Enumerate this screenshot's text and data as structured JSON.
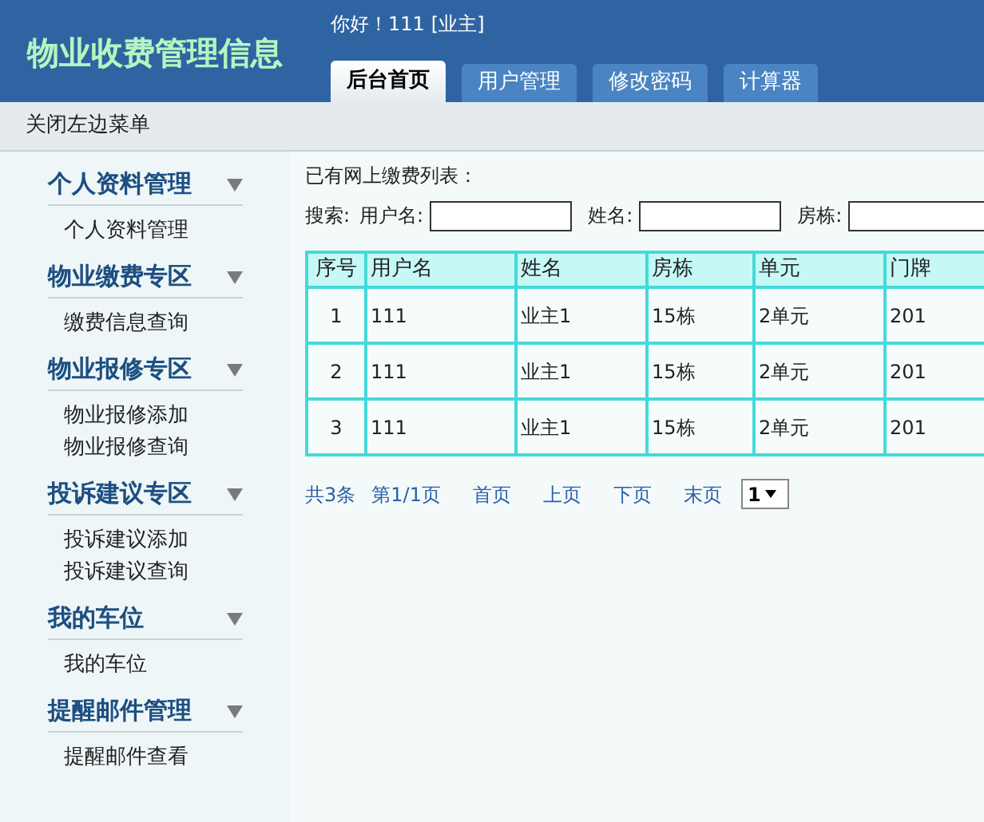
{
  "header": {
    "title": "物业收费管理信息",
    "greeting": "你好！111",
    "role": "[业主]"
  },
  "tabs": [
    {
      "label": "后台首页",
      "selected": true
    },
    {
      "label": "用户管理",
      "selected": false
    },
    {
      "label": "修改密码",
      "selected": false
    },
    {
      "label": "计算器",
      "selected": false
    }
  ],
  "toolbar": {
    "toggle_menu": "关闭左边菜单"
  },
  "sidebar": {
    "sections": [
      {
        "title": "个人资料管理",
        "expanded": true,
        "items": [
          "个人资料管理"
        ]
      },
      {
        "title": "物业缴费专区",
        "expanded": true,
        "items": [
          "缴费信息查询"
        ]
      },
      {
        "title": "物业报修专区",
        "expanded": true,
        "items": [
          "物业报修添加",
          "物业报修查询"
        ]
      },
      {
        "title": "投诉建议专区",
        "expanded": true,
        "items": [
          "投诉建议添加",
          "投诉建议查询"
        ]
      },
      {
        "title": "我的车位",
        "expanded": true,
        "items": [
          "我的车位"
        ]
      },
      {
        "title": "提醒邮件管理",
        "expanded": true,
        "items": [
          "提醒邮件查看"
        ]
      }
    ]
  },
  "main": {
    "heading": "已有网上缴费列表：",
    "search": {
      "label": "搜索:",
      "fields": [
        {
          "label": "用户名:"
        },
        {
          "label": "姓名:"
        },
        {
          "label": "房栋:"
        }
      ]
    },
    "table": {
      "columns": [
        "序号",
        "用户名",
        "姓名",
        "房栋",
        "单元",
        "门牌"
      ],
      "rows": [
        [
          "1",
          "111",
          "业主1",
          "15栋",
          "2单元",
          "201"
        ],
        [
          "2",
          "111",
          "业主1",
          "15栋",
          "2单元",
          "201"
        ],
        [
          "3",
          "111",
          "业主1",
          "15栋",
          "2单元",
          "201"
        ]
      ]
    },
    "pagination": {
      "total": "共3条",
      "page": "第1/1页",
      "links": [
        "首页",
        "上页",
        "下页",
        "末页"
      ],
      "page_select": "1"
    }
  }
}
